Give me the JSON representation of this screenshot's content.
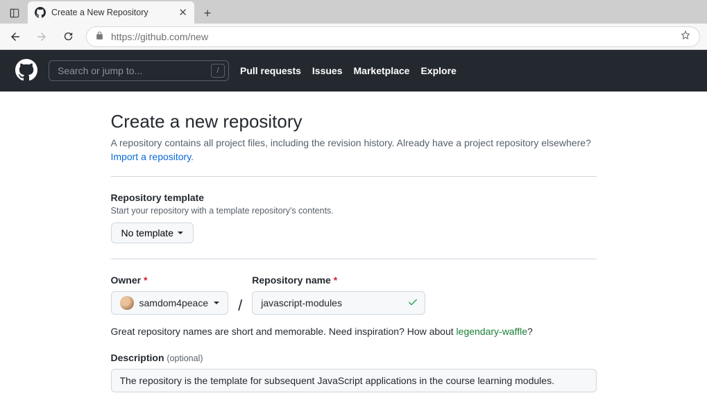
{
  "browser": {
    "tab_title": "Create a New Repository",
    "url": "https://github.com/new"
  },
  "gh_header": {
    "search_placeholder": "Search or jump to...",
    "slash_key": "/",
    "nav": {
      "pull_requests": "Pull requests",
      "issues": "Issues",
      "marketplace": "Marketplace",
      "explore": "Explore"
    }
  },
  "page": {
    "title": "Create a new repository",
    "subtitle_text": "A repository contains all project files, including the revision history. Already have a project repository elsewhere?",
    "import_link": "Import a repository.",
    "template": {
      "label": "Repository template",
      "hint": "Start your repository with a template repository's contents.",
      "button": "No template"
    },
    "owner": {
      "label": "Owner",
      "value": "samdom4peace"
    },
    "repo_name": {
      "label": "Repository name",
      "value": "javascript-modules"
    },
    "hint": {
      "prefix": "Great repository names are short and memorable. Need inspiration? How about ",
      "suggestion": "legendary-waffle",
      "suffix": "?"
    },
    "description": {
      "label": "Description",
      "optional": "(optional)",
      "value": "The repository is the template for subsequent JavaScript applications in the course learning modules."
    }
  }
}
